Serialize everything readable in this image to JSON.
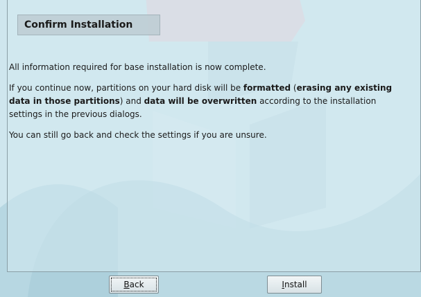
{
  "dialog": {
    "title": "Confirm Installation",
    "line1": "All information required for base installation is now complete.",
    "line2_parts": {
      "a": "If you continue now, partitions on your hard disk will be ",
      "b": "formatted",
      "c": " (",
      "d": "erasing any existing data in those partitions",
      "e": ") and ",
      "f": "data will be overwritten",
      "g": " according to the installation settings in the previous dialogs."
    },
    "line3": "You can still go back and check the settings if you are unsure."
  },
  "buttons": {
    "back": {
      "mnemonic": "B",
      "rest": "ack"
    },
    "install": {
      "mnemonic": "I",
      "rest": "nstall"
    }
  },
  "colors": {
    "background": "#cfe6ee",
    "watermark": "#e7c9d2"
  }
}
